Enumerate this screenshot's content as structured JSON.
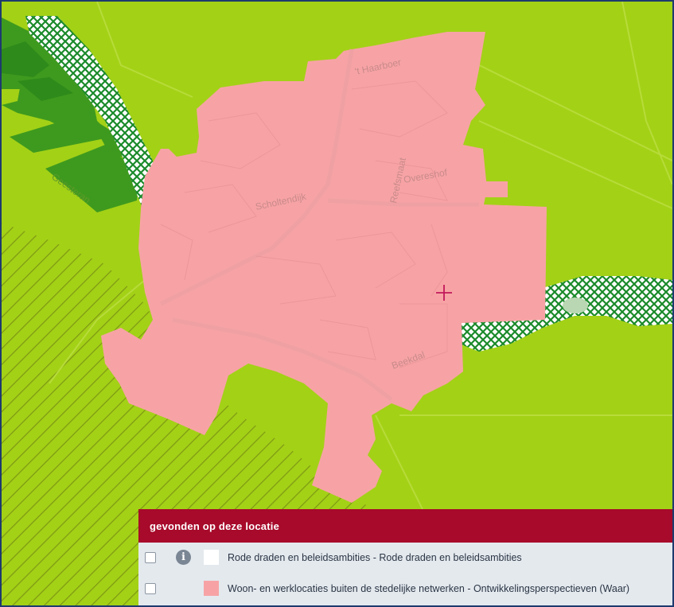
{
  "map": {
    "street_labels": [
      "'t Haarboer",
      "Scholtendijk",
      "Reefsmaat",
      "Overeshof",
      "Beekdal",
      "Geesteran"
    ],
    "colors": {
      "background": "#a3d116",
      "woon_werk_area": "#f7a3a5",
      "water_hatch": "#1a8a2a",
      "dark_fields": "#3e9a1e",
      "diagonal_hatch": "#7aa514"
    },
    "marker_icon": "crosshair-icon"
  },
  "panel": {
    "title": "gevonden op deze locatie",
    "rows": [
      {
        "label": "Rode draden en beleidsambities - Rode draden en beleidsambities",
        "swatch_color": "#ffffff",
        "has_info_icon": true,
        "info_icon": "info-icon",
        "info_glyph": "i",
        "checked": false
      },
      {
        "label": "Woon- en werklocaties buiten de stedelijke netwerken - Ontwikkelingsperspectieven (Waar)",
        "swatch_color": "#f7a3a5",
        "has_info_icon": false,
        "checked": false
      }
    ]
  }
}
